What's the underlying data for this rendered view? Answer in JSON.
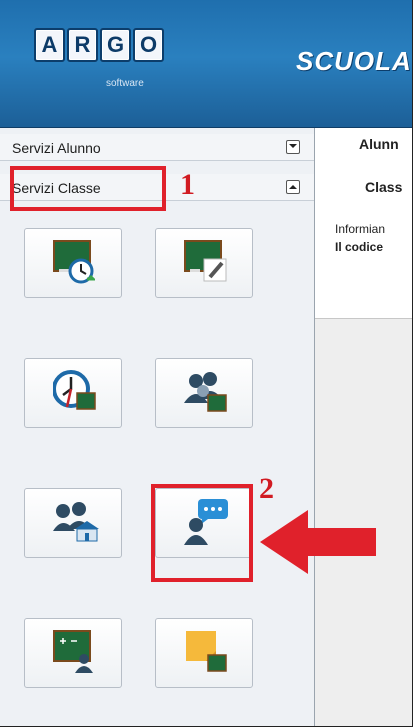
{
  "header": {
    "logo_letters": [
      "A",
      "R",
      "G",
      "O"
    ],
    "logo_subtitle": "software",
    "app_title": "SCUOLAN"
  },
  "sidebar": {
    "sections": [
      {
        "label": "Servizi Alunno",
        "state": "collapsed"
      },
      {
        "label": "Servizi Classe",
        "state": "expanded"
      }
    ],
    "tiles": [
      {
        "icon": "blackboard-clock-icon"
      },
      {
        "icon": "blackboard-note-edit-icon"
      },
      {
        "icon": "clock-blackboard-icon"
      },
      {
        "icon": "people-blackboard-icon"
      },
      {
        "icon": "people-school-icon"
      },
      {
        "icon": "teacher-chat-bubble-icon"
      },
      {
        "icon": "blackboard-math-teacher-icon"
      },
      {
        "icon": "sticky-note-blackboard-icon"
      }
    ]
  },
  "annotations": {
    "step1": "1",
    "step2": "2",
    "highlight_color": "#e0212b"
  },
  "main": {
    "alunno_label": "Alunn",
    "classe_label": "Class",
    "info_line1": "Informian",
    "info_line2": "Il codice"
  },
  "colors": {
    "header_blue": "#2a80bf",
    "blackboard_green": "#1f6b3a",
    "accent_red": "#d11b22"
  }
}
